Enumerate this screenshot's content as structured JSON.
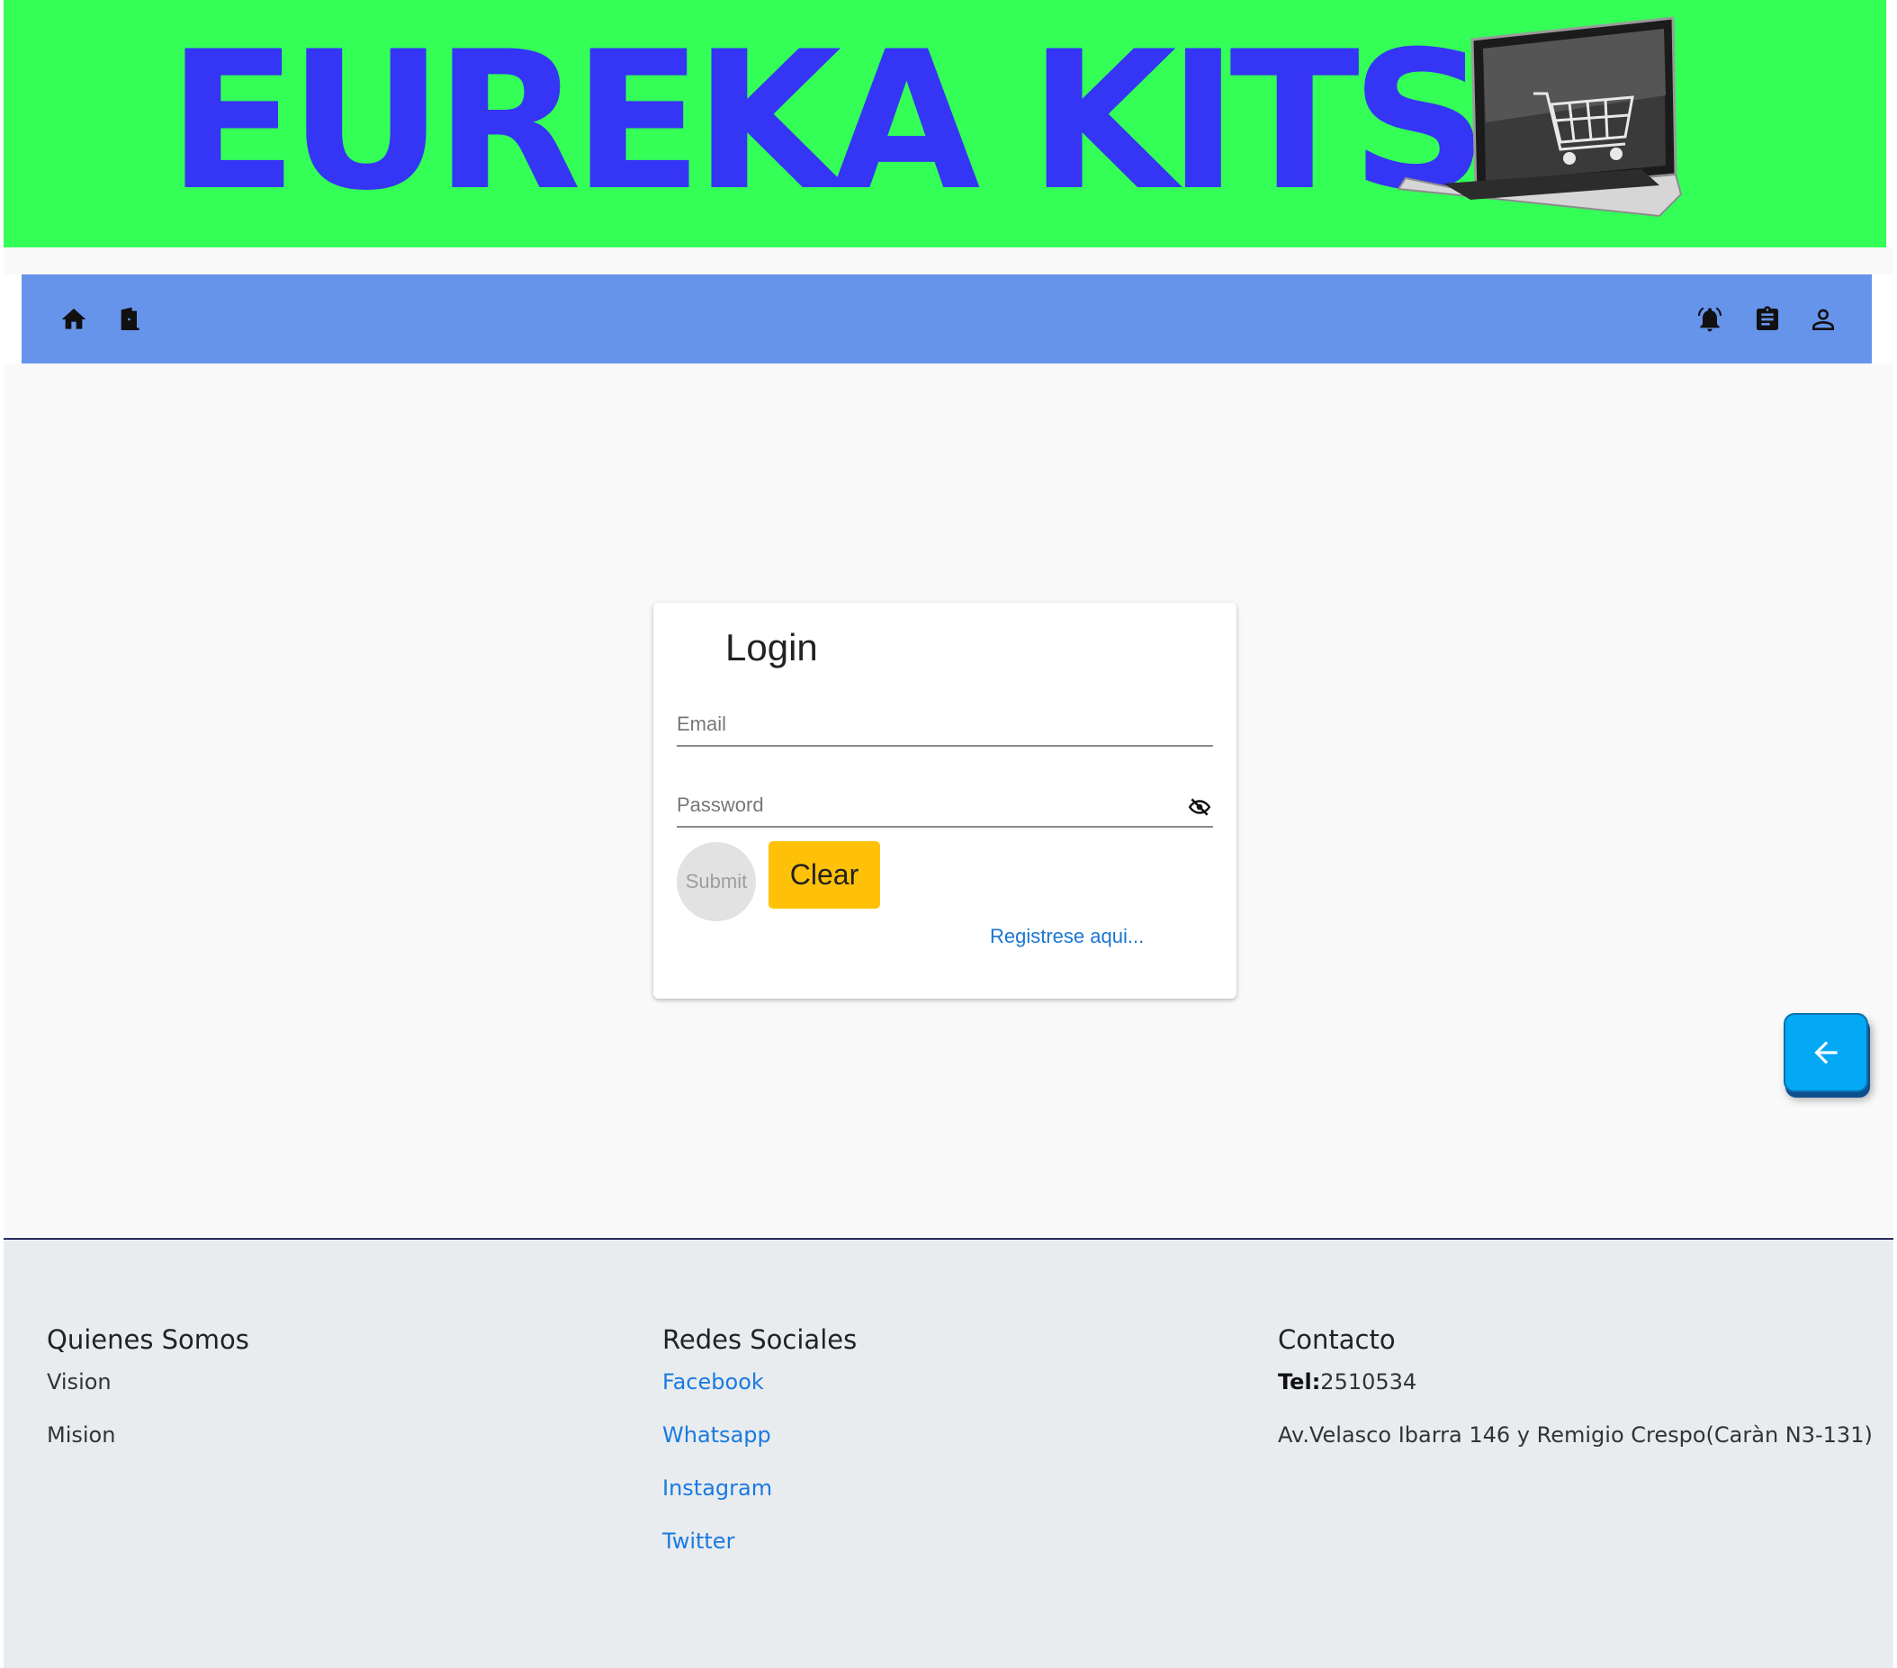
{
  "banner": {
    "brand": "EUREKA KITS",
    "image": "laptop-with-shopping-cart"
  },
  "navbar": {
    "left_icons": [
      "home-icon",
      "door-exit-icon"
    ],
    "right_icons": [
      "notification-bell-icon",
      "clipboard-icon",
      "account-icon"
    ],
    "color": "#6794eb"
  },
  "login": {
    "title": "Login",
    "email_placeholder": "Email",
    "email_value": "",
    "password_placeholder": "Password",
    "password_value": "",
    "submit_label": "Submit",
    "clear_label": "Clear",
    "register_link": "Registrese aqui..."
  },
  "back_button": {
    "icon": "arrow-left-icon"
  },
  "footer": {
    "about": {
      "heading": "Quienes Somos",
      "items": [
        "Vision",
        "Mision"
      ]
    },
    "social": {
      "heading": "Redes Sociales",
      "links": [
        "Facebook",
        "Whatsapp",
        "Instagram",
        "Twitter"
      ]
    },
    "contact": {
      "heading": "Contacto",
      "phone_label": "Tel:",
      "phone": "2510534",
      "address": "Av.Velasco Ibarra 146 y Remigio Crespo(Caràn N3-131)"
    }
  },
  "colors": {
    "banner_bg": "#33ff57",
    "brand_text": "#3535f5",
    "clear_button": "#ffc107",
    "back_button": "#03a9f4",
    "link": "#1a7ae0",
    "footer_bg": "#e9ecef"
  }
}
